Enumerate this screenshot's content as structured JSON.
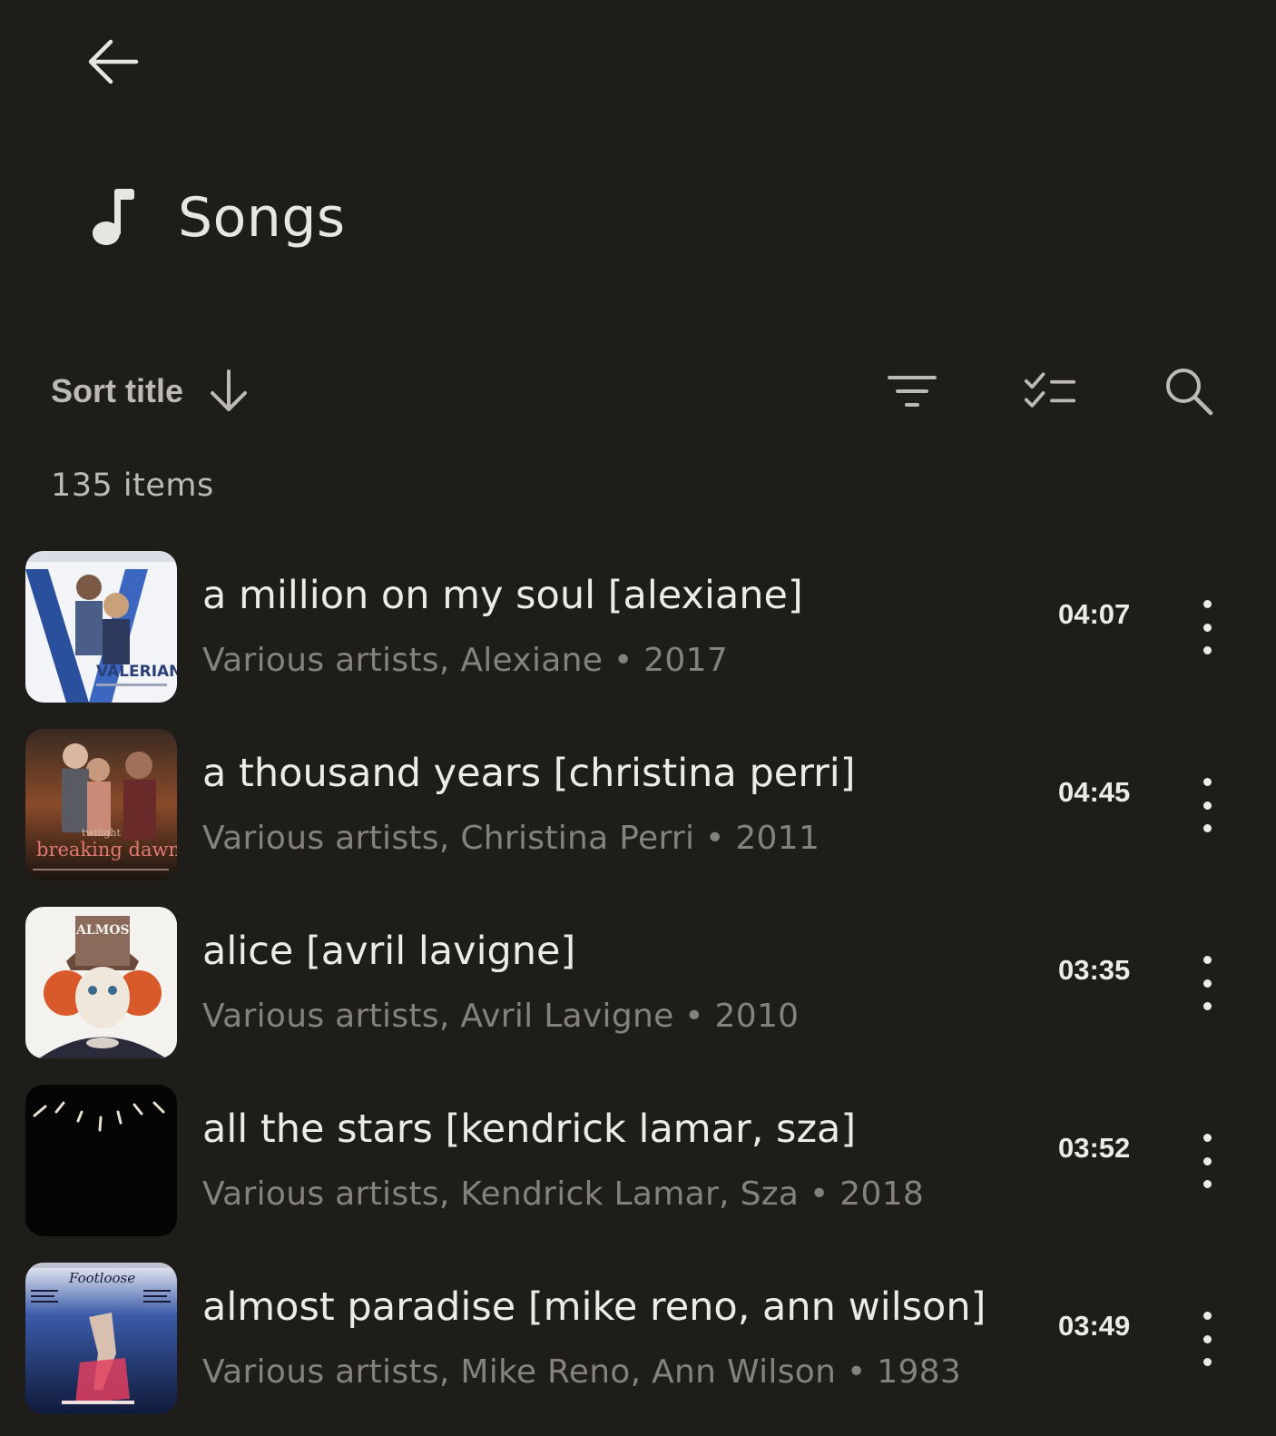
{
  "header": {
    "title": "Songs"
  },
  "toolbar": {
    "sort_label": "Sort title"
  },
  "list": {
    "count_label": "135 items"
  },
  "songs": [
    {
      "title": "a million on my soul [alexiane]",
      "subtitle": "Various artists, Alexiane • 2017",
      "duration": "04:07"
    },
    {
      "title": "a thousand years [christina perri]",
      "subtitle": "Various artists, Christina Perri • 2011",
      "duration": "04:45"
    },
    {
      "title": "alice [avril lavigne]",
      "subtitle": "Various artists, Avril Lavigne • 2010",
      "duration": "03:35"
    },
    {
      "title": "all the stars [kendrick lamar, sza]",
      "subtitle": "Various artists, Kendrick Lamar, Sza • 2018",
      "duration": "03:52"
    },
    {
      "title": "almost paradise [mike reno, ann wilson]",
      "subtitle": "Various artists, Mike Reno, Ann Wilson • 1983",
      "duration": "03:49"
    }
  ],
  "artwork": {
    "art1": "VALERIAN",
    "art2_script": "twilight",
    "art2": "breaking dawn",
    "art3": "ALMOST ALICE",
    "art5": "Footloose"
  },
  "colors": {
    "background": "#1f1d1a",
    "primary_text": "#ecebe8",
    "secondary_text": "#85827d",
    "toolbar_text": "#bdbab5"
  },
  "icons": {
    "back": "arrow-left-icon",
    "header": "music-note-icon",
    "sort_direction": "arrow-down-icon",
    "filter": "filter-icon",
    "select": "checklist-icon",
    "search": "search-icon",
    "more": "more-vertical-icon"
  }
}
